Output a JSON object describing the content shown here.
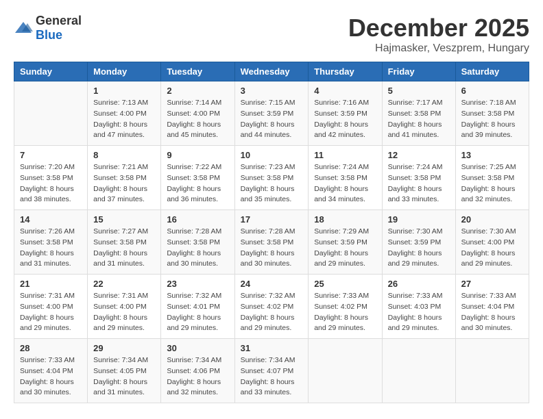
{
  "logo": {
    "text_general": "General",
    "text_blue": "Blue"
  },
  "header": {
    "month": "December 2025",
    "location": "Hajmasker, Veszprem, Hungary"
  },
  "days_of_week": [
    "Sunday",
    "Monday",
    "Tuesday",
    "Wednesday",
    "Thursday",
    "Friday",
    "Saturday"
  ],
  "weeks": [
    [
      {
        "day": "",
        "info": ""
      },
      {
        "day": "1",
        "info": "Sunrise: 7:13 AM\nSunset: 4:00 PM\nDaylight: 8 hours\nand 47 minutes."
      },
      {
        "day": "2",
        "info": "Sunrise: 7:14 AM\nSunset: 4:00 PM\nDaylight: 8 hours\nand 45 minutes."
      },
      {
        "day": "3",
        "info": "Sunrise: 7:15 AM\nSunset: 3:59 PM\nDaylight: 8 hours\nand 44 minutes."
      },
      {
        "day": "4",
        "info": "Sunrise: 7:16 AM\nSunset: 3:59 PM\nDaylight: 8 hours\nand 42 minutes."
      },
      {
        "day": "5",
        "info": "Sunrise: 7:17 AM\nSunset: 3:58 PM\nDaylight: 8 hours\nand 41 minutes."
      },
      {
        "day": "6",
        "info": "Sunrise: 7:18 AM\nSunset: 3:58 PM\nDaylight: 8 hours\nand 39 minutes."
      }
    ],
    [
      {
        "day": "7",
        "info": "Sunrise: 7:20 AM\nSunset: 3:58 PM\nDaylight: 8 hours\nand 38 minutes."
      },
      {
        "day": "8",
        "info": "Sunrise: 7:21 AM\nSunset: 3:58 PM\nDaylight: 8 hours\nand 37 minutes."
      },
      {
        "day": "9",
        "info": "Sunrise: 7:22 AM\nSunset: 3:58 PM\nDaylight: 8 hours\nand 36 minutes."
      },
      {
        "day": "10",
        "info": "Sunrise: 7:23 AM\nSunset: 3:58 PM\nDaylight: 8 hours\nand 35 minutes."
      },
      {
        "day": "11",
        "info": "Sunrise: 7:24 AM\nSunset: 3:58 PM\nDaylight: 8 hours\nand 34 minutes."
      },
      {
        "day": "12",
        "info": "Sunrise: 7:24 AM\nSunset: 3:58 PM\nDaylight: 8 hours\nand 33 minutes."
      },
      {
        "day": "13",
        "info": "Sunrise: 7:25 AM\nSunset: 3:58 PM\nDaylight: 8 hours\nand 32 minutes."
      }
    ],
    [
      {
        "day": "14",
        "info": "Sunrise: 7:26 AM\nSunset: 3:58 PM\nDaylight: 8 hours\nand 31 minutes."
      },
      {
        "day": "15",
        "info": "Sunrise: 7:27 AM\nSunset: 3:58 PM\nDaylight: 8 hours\nand 31 minutes."
      },
      {
        "day": "16",
        "info": "Sunrise: 7:28 AM\nSunset: 3:58 PM\nDaylight: 8 hours\nand 30 minutes."
      },
      {
        "day": "17",
        "info": "Sunrise: 7:28 AM\nSunset: 3:58 PM\nDaylight: 8 hours\nand 30 minutes."
      },
      {
        "day": "18",
        "info": "Sunrise: 7:29 AM\nSunset: 3:59 PM\nDaylight: 8 hours\nand 29 minutes."
      },
      {
        "day": "19",
        "info": "Sunrise: 7:30 AM\nSunset: 3:59 PM\nDaylight: 8 hours\nand 29 minutes."
      },
      {
        "day": "20",
        "info": "Sunrise: 7:30 AM\nSunset: 4:00 PM\nDaylight: 8 hours\nand 29 minutes."
      }
    ],
    [
      {
        "day": "21",
        "info": "Sunrise: 7:31 AM\nSunset: 4:00 PM\nDaylight: 8 hours\nand 29 minutes."
      },
      {
        "day": "22",
        "info": "Sunrise: 7:31 AM\nSunset: 4:00 PM\nDaylight: 8 hours\nand 29 minutes."
      },
      {
        "day": "23",
        "info": "Sunrise: 7:32 AM\nSunset: 4:01 PM\nDaylight: 8 hours\nand 29 minutes."
      },
      {
        "day": "24",
        "info": "Sunrise: 7:32 AM\nSunset: 4:02 PM\nDaylight: 8 hours\nand 29 minutes."
      },
      {
        "day": "25",
        "info": "Sunrise: 7:33 AM\nSunset: 4:02 PM\nDaylight: 8 hours\nand 29 minutes."
      },
      {
        "day": "26",
        "info": "Sunrise: 7:33 AM\nSunset: 4:03 PM\nDaylight: 8 hours\nand 29 minutes."
      },
      {
        "day": "27",
        "info": "Sunrise: 7:33 AM\nSunset: 4:04 PM\nDaylight: 8 hours\nand 30 minutes."
      }
    ],
    [
      {
        "day": "28",
        "info": "Sunrise: 7:33 AM\nSunset: 4:04 PM\nDaylight: 8 hours\nand 30 minutes."
      },
      {
        "day": "29",
        "info": "Sunrise: 7:34 AM\nSunset: 4:05 PM\nDaylight: 8 hours\nand 31 minutes."
      },
      {
        "day": "30",
        "info": "Sunrise: 7:34 AM\nSunset: 4:06 PM\nDaylight: 8 hours\nand 32 minutes."
      },
      {
        "day": "31",
        "info": "Sunrise: 7:34 AM\nSunset: 4:07 PM\nDaylight: 8 hours\nand 33 minutes."
      },
      {
        "day": "",
        "info": ""
      },
      {
        "day": "",
        "info": ""
      },
      {
        "day": "",
        "info": ""
      }
    ]
  ]
}
